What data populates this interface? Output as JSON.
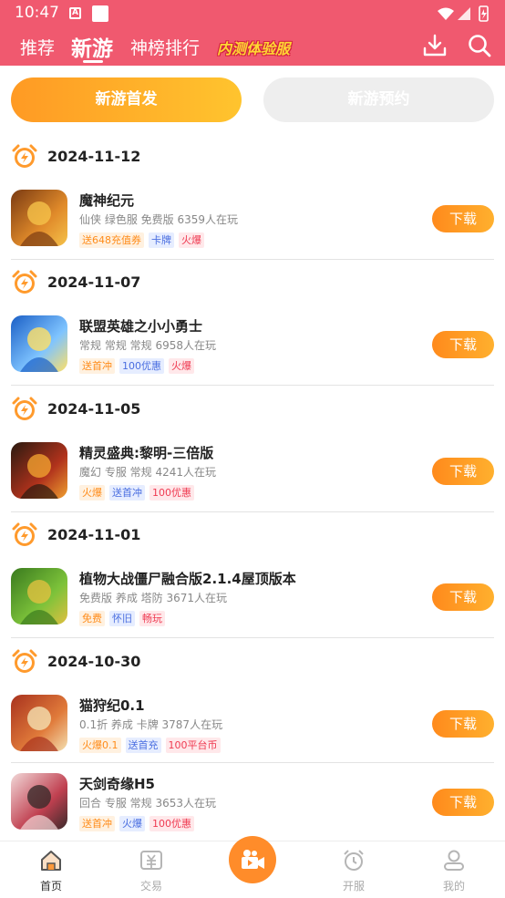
{
  "status_bar": {
    "time": "10:47",
    "notif_a": "A"
  },
  "nav": {
    "tabs": [
      "推荐",
      "新游",
      "神榜排行"
    ],
    "active_tab": "新游",
    "promo": "内测体验服"
  },
  "segments": {
    "left": "新游首发",
    "right": "新游预约"
  },
  "sections": [
    {
      "date": "2024-11-12",
      "games": [
        {
          "title": "魔神纪元",
          "meta": "仙侠 绿色服 免费版  6359人在玩",
          "tags": [
            [
              "送648充值券",
              "orange"
            ],
            [
              "卡牌",
              "blue"
            ],
            [
              "火爆",
              "red"
            ]
          ],
          "btn": "下载"
        }
      ]
    },
    {
      "date": "2024-11-07",
      "games": [
        {
          "title": "联盟英雄之小小勇士",
          "meta": "常规 常规 常规  6958人在玩",
          "tags": [
            [
              "送首冲",
              "orange"
            ],
            [
              "100优惠",
              "blue"
            ],
            [
              "火爆",
              "red"
            ]
          ],
          "btn": "下载"
        }
      ]
    },
    {
      "date": "2024-11-05",
      "games": [
        {
          "title": "精灵盛典:黎明-三倍版",
          "meta": "魔幻 专服 常规  4241人在玩",
          "tags": [
            [
              "火爆",
              "orange"
            ],
            [
              "送首冲",
              "blue"
            ],
            [
              "100优惠",
              "red"
            ]
          ],
          "btn": "下载"
        }
      ]
    },
    {
      "date": "2024-11-01",
      "games": [
        {
          "title": "植物大战僵尸融合版2.1.4屋顶版本",
          "meta": "免费版 养成 塔防  3671人在玩",
          "tags": [
            [
              "免费",
              "orange"
            ],
            [
              "怀旧",
              "blue"
            ],
            [
              "畅玩",
              "red"
            ]
          ],
          "btn": "下载"
        }
      ]
    },
    {
      "date": "2024-10-30",
      "games": [
        {
          "title": "猫狩纪0.1",
          "meta": "0.1折 养成 卡牌  3787人在玩",
          "tags": [
            [
              "火爆0.1",
              "orange"
            ],
            [
              "送首充",
              "blue"
            ],
            [
              "100平台币",
              "red"
            ]
          ],
          "btn": "下载"
        },
        {
          "title": "天剑奇缘H5",
          "meta": "回合 专服 常规  3653人在玩",
          "tags": [
            [
              "送首冲",
              "orange"
            ],
            [
              "火爆",
              "blue"
            ],
            [
              "100优惠",
              "red"
            ]
          ],
          "btn": "下载"
        }
      ]
    }
  ],
  "bottom_tabs": [
    {
      "label": "首页",
      "icon": "home-icon"
    },
    {
      "label": "交易",
      "icon": "trade-icon"
    },
    {
      "label": "",
      "icon": "video-camera-icon"
    },
    {
      "label": "开服",
      "icon": "alarm-clock-icon"
    },
    {
      "label": "我的",
      "icon": "user-icon"
    }
  ],
  "colors": {
    "header": "#f0596f",
    "accent": "#ff8c2a",
    "promo": "#ffd633"
  }
}
